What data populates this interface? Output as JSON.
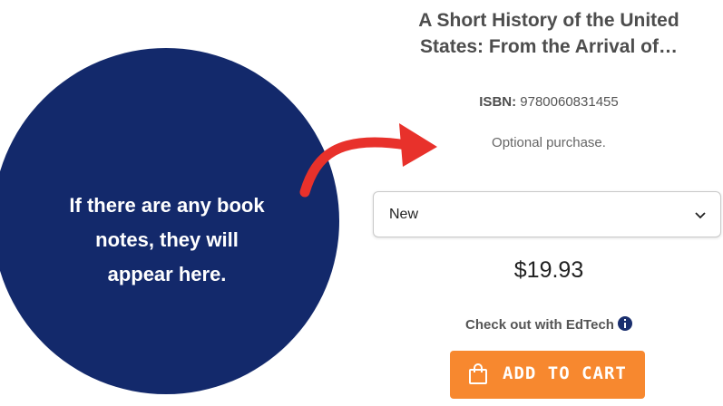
{
  "product": {
    "title_line1": "A Short History of the United",
    "title_line2": "States: From the Arrival of…",
    "isbn_label": "ISBN:",
    "isbn_value": "9780060831455",
    "purchase_note": "Optional purchase.",
    "condition_selected": "New",
    "price": "$19.93",
    "checkout_text": "Check out with EdTech",
    "add_to_cart_label": "ADD TO CART"
  },
  "callout": {
    "text_line1": "If there are any book",
    "text_line2": "notes, they will",
    "text_line3": "appear here."
  },
  "colors": {
    "circle": "#13296b",
    "arrow": "#e8312b",
    "button": "#f7882f",
    "info_icon": "#1a2f6e"
  },
  "icons": [
    "chevron-down-icon",
    "info-icon",
    "shopping-bag-icon",
    "curved-arrow-icon"
  ]
}
